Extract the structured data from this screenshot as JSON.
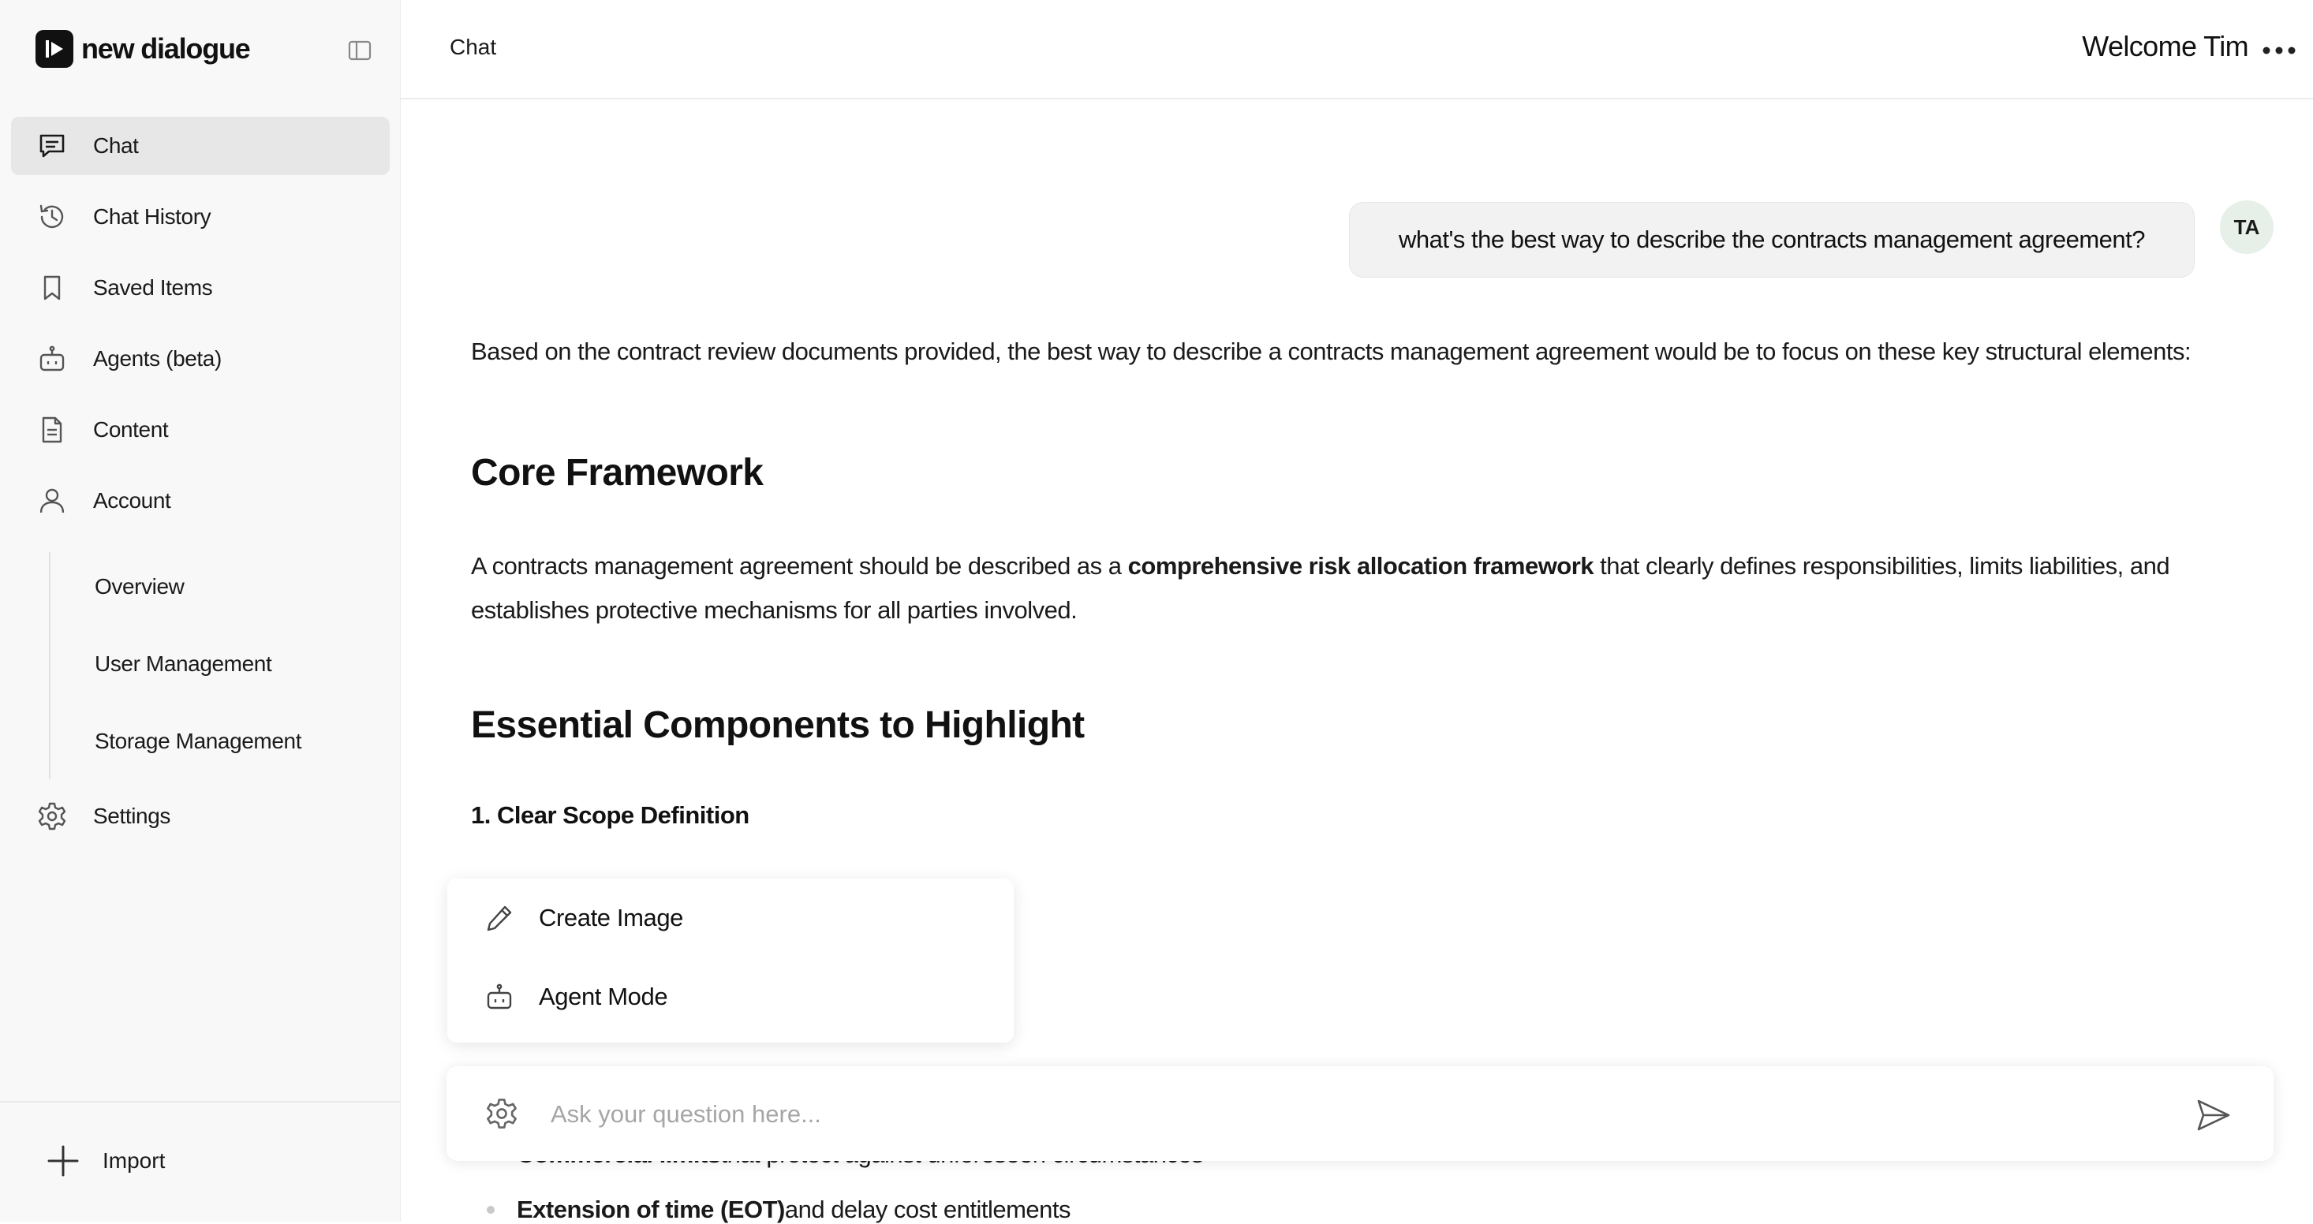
{
  "app": {
    "logo_text": "new dialogue"
  },
  "sidebar": {
    "items": [
      {
        "label": "Chat",
        "icon": "chat-icon",
        "active": true
      },
      {
        "label": "Chat History",
        "icon": "history-icon"
      },
      {
        "label": "Saved Items",
        "icon": "bookmark-icon"
      },
      {
        "label": "Agents (beta)",
        "icon": "robot-icon"
      },
      {
        "label": "Content",
        "icon": "document-icon"
      },
      {
        "label": "Account",
        "icon": "user-icon"
      }
    ],
    "account_subitems": [
      "Overview",
      "User Management",
      "Storage Management"
    ],
    "settings_label": "Settings",
    "import_label": "Import"
  },
  "header": {
    "title": "Chat",
    "welcome": "Welcome Tim"
  },
  "conversation": {
    "user_message": "what's the best way to describe the contracts management agreement?",
    "user_avatar": "TA",
    "response": {
      "intro": "Based on the contract review documents provided, the best way to describe a contracts management agreement would be to focus on these key structural elements:",
      "heading_core": "Core Framework",
      "core_before": "A contracts management agreement should be described as a ",
      "core_bold": "comprehensive risk allocation framework",
      "core_after": " that clearly defines responsibilities, limits liabilities, and establishes protective mechanisms for all parties involved.",
      "heading_essential": "Essential Components to Highlight",
      "scope_title": "1. Clear Scope Definition",
      "bullets": [
        {
          "bold": "Commercial limits",
          "rest": " that protect against unforeseen circumstances"
        },
        {
          "bold": "Extension of time (EOT)",
          "rest": " and delay cost entitlements"
        }
      ]
    }
  },
  "tools_menu": {
    "items": [
      {
        "label": "Create Image",
        "icon": "pencil-icon"
      },
      {
        "label": "Agent Mode",
        "icon": "robot-icon"
      }
    ]
  },
  "composer": {
    "placeholder": "Ask your question here...",
    "value": ""
  },
  "colors": {
    "sidebar_bg": "#f8f8f8",
    "active_item_bg": "#e7e7e7",
    "avatar_bg": "#e6efe8",
    "text": "#111111"
  }
}
